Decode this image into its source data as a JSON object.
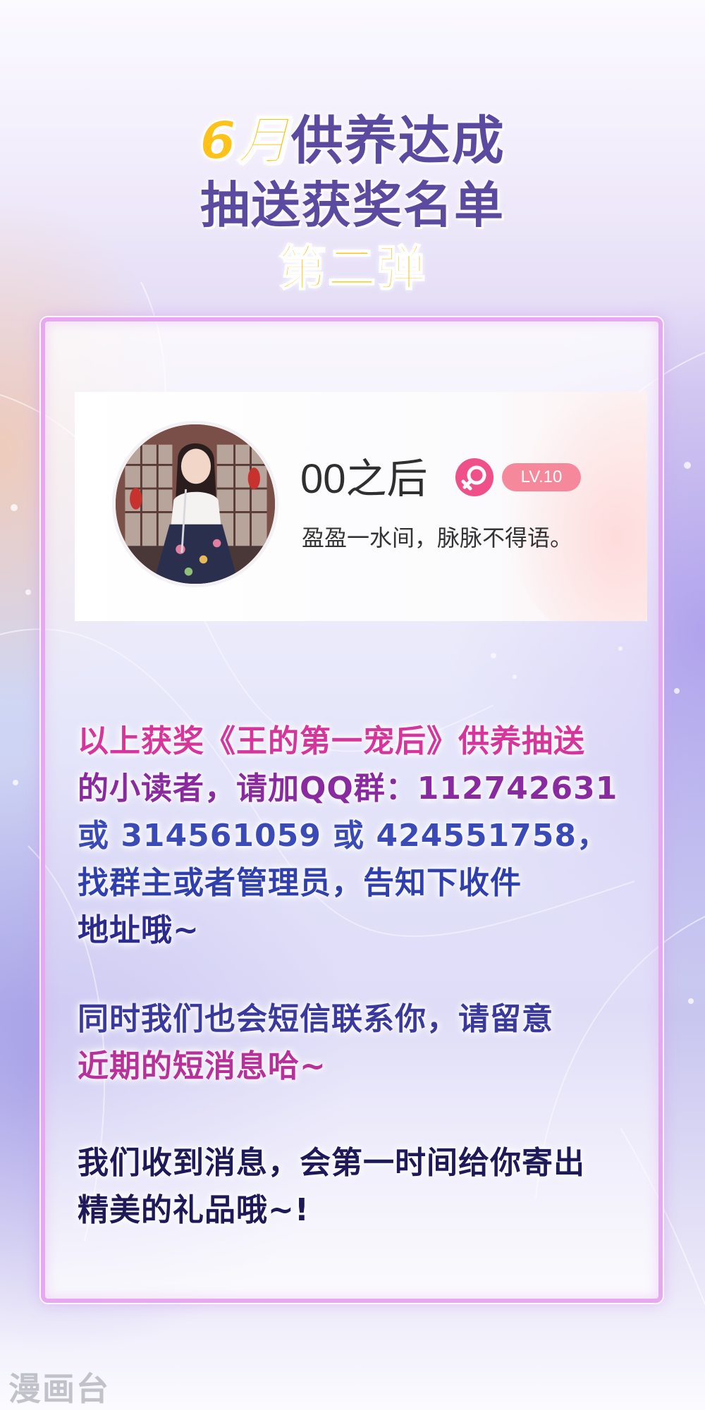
{
  "header": {
    "title_line1_highlight": "6月",
    "title_line1_rest": "供养达成",
    "title_line2": "抽送获奖名单",
    "title_line3": "第二弹"
  },
  "profile": {
    "username": "00之后",
    "level": "LV.10",
    "signature": "盈盈一水间，脉脉不得语。",
    "gender_icon": "female-icon"
  },
  "notice": {
    "p1_lines": [
      "以上获奖《王的第一宠后》供养抽送",
      "的小读者，请加QQ群：112742631",
      "或 314561059 或 424551758，",
      "找群主或者管理员，告知下收件",
      "地址哦~"
    ],
    "p2_lines": [
      "同时我们也会短信联系你，请留意",
      "近期的短消息哈~"
    ],
    "p3_lines": [
      "我们收到消息，会第一时间给你寄出",
      "精美的礼品哦~!"
    ]
  },
  "watermark": "漫画台",
  "colors": {
    "title_purple": "#5a4aa0",
    "title_yellow": "#ffc21a",
    "card_border": "#e6a9f0",
    "badge_pink": "#f6889b",
    "gender_pink": "#f0508a",
    "text_magenta": "#d6369c",
    "text_blue": "#3a4bb8",
    "text_navy": "#1e1a5a"
  }
}
